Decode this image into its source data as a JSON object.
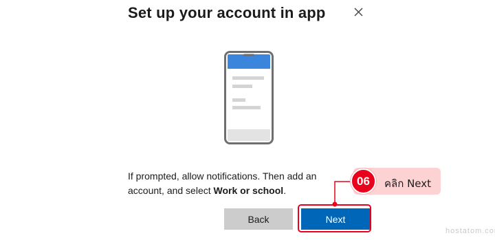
{
  "dialog": {
    "title": "Set up your account in app",
    "close_icon": "close-icon",
    "illustration_icon": "smartphone-icon",
    "body_prefix": "If prompted, allow notifications. Then add an account, and select ",
    "body_bold": "Work or school",
    "body_suffix": "."
  },
  "buttons": {
    "back_label": "Back",
    "next_label": "Next"
  },
  "annotation": {
    "step_number": "06",
    "instruction": "คลิก Next"
  },
  "watermark": "hostatom.com",
  "colors": {
    "primary": "#0067b8",
    "secondary_button": "#cccccc",
    "highlight": "#e8001c",
    "callout_background": "#fcd2d3",
    "phone_header": "#3b86dc"
  }
}
